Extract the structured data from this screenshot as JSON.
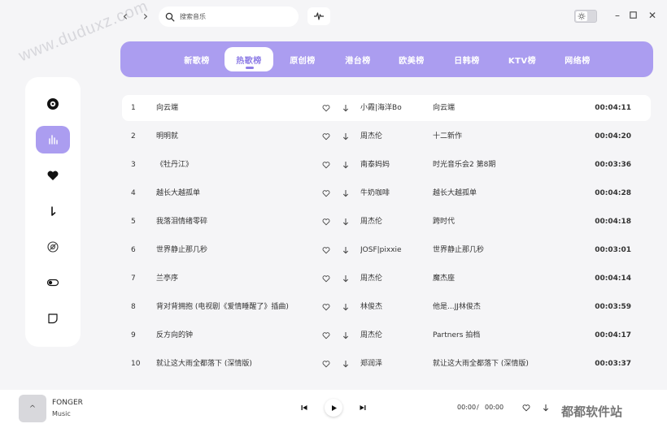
{
  "watermark": "www.duduxz.com",
  "search": {
    "placeholder": "搜索音乐"
  },
  "tabs": [
    "新歌榜",
    "热歌榜",
    "原创榜",
    "港台榜",
    "欧美榜",
    "日韩榜",
    "KTV榜",
    "网络榜"
  ],
  "active_tab": 1,
  "sidebar": {
    "items": [
      {
        "icon": "disc-icon"
      },
      {
        "icon": "chart-bars-icon",
        "active": true
      },
      {
        "icon": "heart-icon"
      },
      {
        "icon": "download-icon"
      },
      {
        "icon": "cd-icon"
      },
      {
        "icon": "toggle-icon"
      },
      {
        "icon": "shield-icon"
      }
    ]
  },
  "songs": [
    {
      "idx": "1",
      "title": "向云端",
      "artist": "小霞|海洋Bo",
      "album": "向云端",
      "duration": "00:04:11"
    },
    {
      "idx": "2",
      "title": "明明就",
      "artist": "周杰伦",
      "album": "十二新作",
      "duration": "00:04:20"
    },
    {
      "idx": "3",
      "title": "《牡丹江》",
      "artist": "南泰妈妈",
      "album": "时光音乐会2 第8期",
      "duration": "00:03:36"
    },
    {
      "idx": "4",
      "title": "越长大越孤单",
      "artist": "牛奶咖啡",
      "album": "越长大越孤单",
      "duration": "00:04:28"
    },
    {
      "idx": "5",
      "title": "我落泪情绪零碎",
      "artist": "周杰伦",
      "album": "跨时代",
      "duration": "00:04:18"
    },
    {
      "idx": "6",
      "title": "世界静止那几秒",
      "artist": "JOSF|pixxie",
      "album": "世界静止那几秒",
      "duration": "00:03:01"
    },
    {
      "idx": "7",
      "title": "兰亭序",
      "artist": "周杰伦",
      "album": "魔杰座",
      "duration": "00:04:14"
    },
    {
      "idx": "8",
      "title": "背对背拥抱 (电视剧《爱情睡醒了》插曲)",
      "artist": "林俊杰",
      "album": "他是...JJ林俊杰",
      "duration": "00:03:59"
    },
    {
      "idx": "9",
      "title": "反方向的钟",
      "artist": "周杰伦",
      "album": "Partners 拍档",
      "duration": "00:04:17"
    },
    {
      "idx": "10",
      "title": "就让这大雨全都落下 (深情版)",
      "artist": "郑润泽",
      "album": "就让这大雨全都落下 (深情版)",
      "duration": "00:03:37"
    }
  ],
  "player": {
    "cover_label": "^",
    "song_name": "FONGER",
    "song_sub": "Music",
    "current_time": "00:00",
    "separator": "/",
    "total_time": "00:00"
  },
  "brand": "都都软件站",
  "colors": {
    "accent": "#ab9df0",
    "accent_dark": "#8f7ee6"
  }
}
